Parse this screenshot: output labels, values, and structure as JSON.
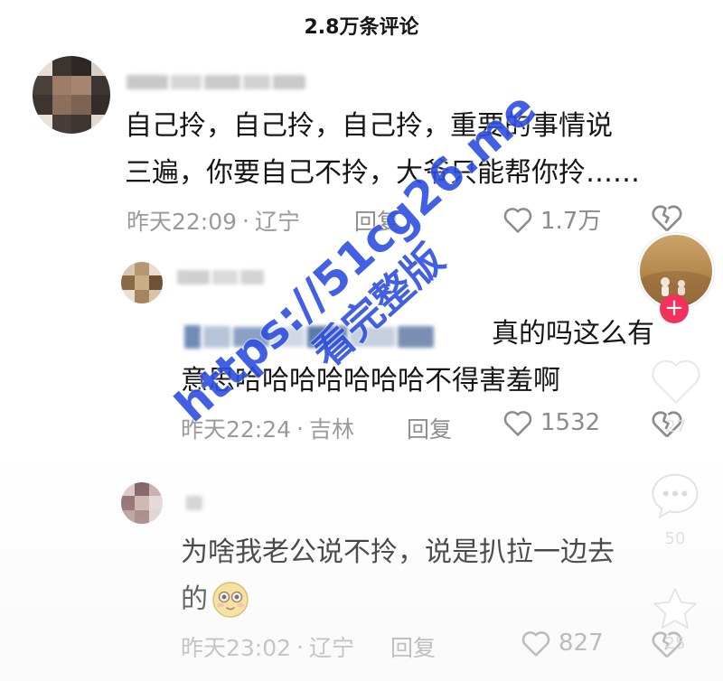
{
  "header": {
    "title": "2.8万条评论"
  },
  "comments": [
    {
      "text_line1": "自己拎，自己拎，自己拎，重要的事情说",
      "text_line2": "三遍，你要自己不拎，大爷只能帮你拎……",
      "time": "昨天22:09",
      "location": "辽宁",
      "reply_label": "回复",
      "like_count": "1.7万"
    },
    {
      "quote_suffix": "真的吗这么有",
      "text_line2": "意思哈哈哈哈哈哈哈不得害羞啊",
      "time": "昨天22:24",
      "location": "吉林",
      "reply_label": "回复",
      "like_count": "1532"
    },
    {
      "text_line1": "为啥我老公说不拎，说是扒拉一边去",
      "text_line2": "的",
      "time": "昨天23:02",
      "location": "辽宁",
      "reply_label": "回复",
      "like_count": "827"
    }
  ],
  "side_actions": {
    "like_count": "27",
    "comment_count": "50",
    "favorite_count": "25"
  },
  "watermark": {
    "line1": "https://51cg26.me",
    "line2": "看完整版"
  },
  "colors": {
    "follow_button": "#f2325b",
    "watermark": "#2e4fe0",
    "meta_text": "#9a9a9a"
  }
}
